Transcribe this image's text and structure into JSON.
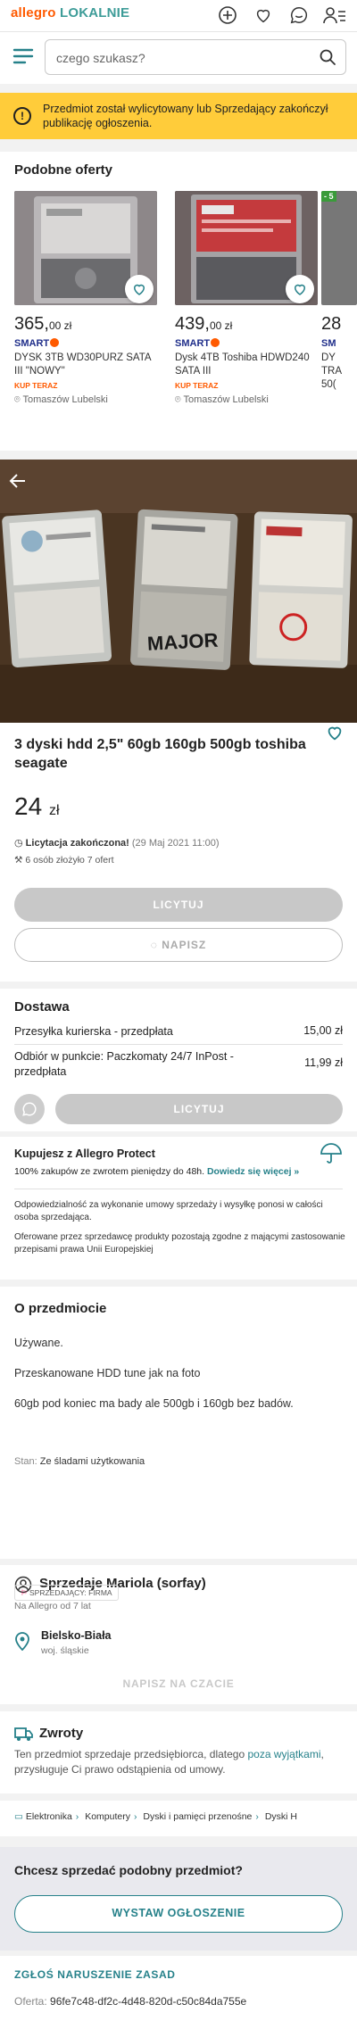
{
  "header": {
    "logo_part1": "allegro",
    "logo_part2": "LOKALNIE",
    "icons": [
      "plus-circle-icon",
      "heart-icon",
      "chat-icon",
      "user-menu-icon"
    ]
  },
  "search": {
    "placeholder": "czego szukasz?"
  },
  "alert": {
    "text": "Przedmiot został wylicytowany lub Sprzedający zakończył publikację ogłoszenia."
  },
  "similar": {
    "title": "Podobne oferty",
    "offers": [
      {
        "price": "365,",
        "cents": "00 zł",
        "smart": "SMART",
        "title": "DYSK 3TB WD30PURZ SATA III \"NOWY\"",
        "buy": "KUP TERAZ",
        "location": "Tomaszów Lubelski"
      },
      {
        "price": "439,",
        "cents": "00 zł",
        "smart": "SMART",
        "title": "Dysk 4TB Toshiba HDWD240 SATA III",
        "buy": "KUP TERAZ",
        "location": "Tomaszów Lubelski"
      },
      {
        "price": "28",
        "cents": "",
        "smart": "SM",
        "title": "DY TRA 50(",
        "buy": "",
        "location": ""
      }
    ],
    "partial_badge": "- 5"
  },
  "listing": {
    "title": "3 dyski hdd 2,5\" 60gb 160gb 500gb toshiba seagate",
    "price_value": "24",
    "price_unit": "zł",
    "auction_status": "Licytacja zakończona!",
    "auction_date": "(29 Maj 2021 11:00)",
    "bids": "6 osób złożyło 7 ofert",
    "bid_label": "LICYTUJ",
    "message_label": "NAPISZ",
    "drive_labels": [
      "MAJOR"
    ]
  },
  "delivery": {
    "title": "Dostawa",
    "options": [
      {
        "label": "Przesyłka kurierska - przedpłata",
        "price": "15,00 zł"
      },
      {
        "label": "Odbiór w punkcie: Paczkomaty 24/7 InPost - przedpłata",
        "price": "11,99 zł"
      }
    ],
    "bid_label": "LICYTUJ"
  },
  "protect": {
    "title": "Kupujesz z Allegro Protect",
    "text": "100% zakupów ze zwrotem pieniędzy do 48h.",
    "link": "Dowiedz się więcej »",
    "p1": "Odpowiedzialność za wykonanie umowy sprzedaży i wysyłkę ponosi w całości osoba sprzedająca.",
    "p2": "Oferowane przez sprzedawcę produkty pozostają zgodne z mającymi zastosowanie przepisami prawa Unii Europejskiej"
  },
  "about": {
    "title": "O przedmiocie",
    "paragraphs": [
      "Używane.",
      "Przeskanowane HDD tune jak na foto",
      "60gb pod koniec ma bady ale 500gb i 160gb bez badów."
    ],
    "state_label": "Stan:",
    "state_value": "Ze śladami użytkowania"
  },
  "seller": {
    "name": "Sprzedaje Mariola (sorfay)",
    "since": "Na Allegro od 7 lat",
    "badge": "SPRZEDAJĄCY: FIRMA",
    "city": "Bielsko-Biała",
    "region": "woj. śląskie",
    "message_button": "NAPISZ NA CZACIE"
  },
  "returns": {
    "title": "Zwroty",
    "text_before": "Ten przedmiot sprzedaje przedsiębiorca, dlatego ",
    "link": "poza wyjątkami",
    "text_after": ", przysługuje Ci prawo odstąpienia od umowy."
  },
  "breadcrumbs": [
    "Elektronika",
    "Komputery",
    "Dyski i pamięci przenośne",
    "Dyski H"
  ],
  "sell": {
    "question": "Chcesz sprzedać podobny przedmiot?",
    "button": "WYSTAW OGŁOSZENIE"
  },
  "report": {
    "label": "ZGŁOŚ NARUSZENIE ZASAD",
    "offer_label": "Oferta:",
    "offer_id": "96fe7c48-df2c-4d48-820d-c50c84da755e"
  },
  "colors": {
    "brand_orange": "#ff5a00",
    "brand_teal": "#26818a",
    "alert_yellow": "#ffcc3a",
    "smart_navy": "#1f2e8a"
  }
}
